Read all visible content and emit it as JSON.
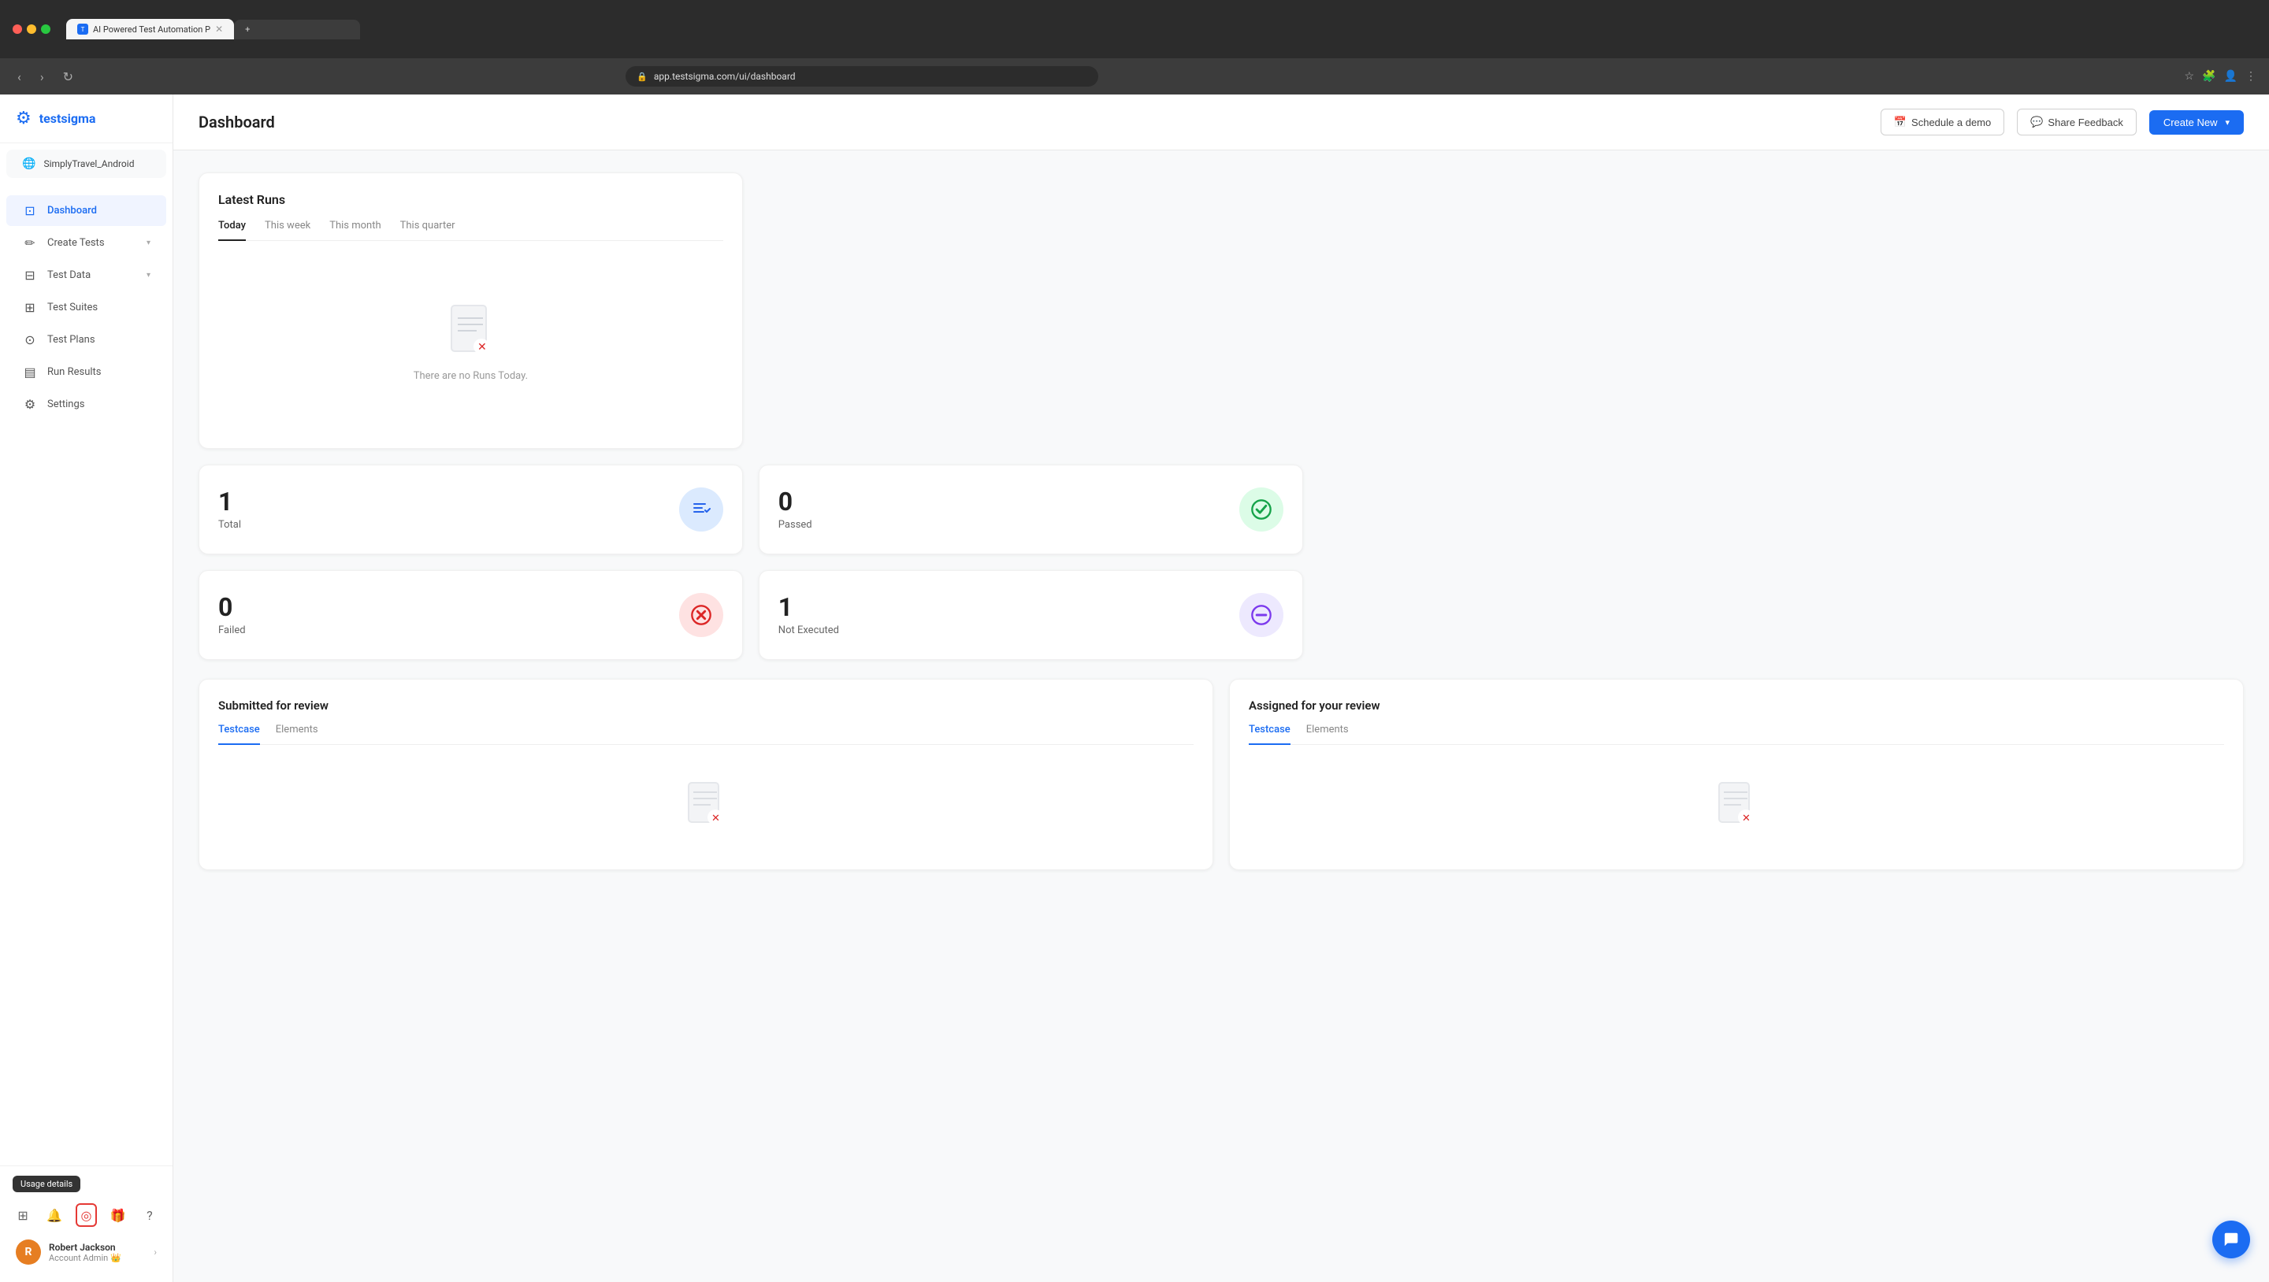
{
  "browser": {
    "tab_title": "AI Powered Test Automation P",
    "tab_new_label": "+",
    "address": "app.testsigma.com/ui/dashboard",
    "nav_back": "‹",
    "nav_forward": "›",
    "nav_refresh": "↻"
  },
  "logo": {
    "icon": "⚙",
    "text": "testsigma"
  },
  "sidebar": {
    "project_name": "SimplyTravel_Android",
    "items": [
      {
        "id": "dashboard",
        "label": "Dashboard",
        "icon": "⊡",
        "active": true
      },
      {
        "id": "create-tests",
        "label": "Create Tests",
        "icon": "✏",
        "has_chevron": true
      },
      {
        "id": "test-data",
        "label": "Test Data",
        "icon": "⊟",
        "has_chevron": true
      },
      {
        "id": "test-suites",
        "label": "Test Suites",
        "icon": "⊞"
      },
      {
        "id": "test-plans",
        "label": "Test Plans",
        "icon": "⊙"
      },
      {
        "id": "run-results",
        "label": "Run Results",
        "icon": "▤"
      },
      {
        "id": "settings",
        "label": "Settings",
        "icon": "⚙"
      }
    ],
    "bottom_icons": [
      {
        "id": "grid-icon",
        "symbol": "⊞",
        "highlighted": false
      },
      {
        "id": "bell-icon",
        "symbol": "🔔",
        "highlighted": false
      },
      {
        "id": "circle-icon",
        "symbol": "◎",
        "highlighted": true
      },
      {
        "id": "gift-icon",
        "symbol": "🎁",
        "highlighted": false
      },
      {
        "id": "help-icon",
        "symbol": "?",
        "highlighted": false
      }
    ],
    "usage_tooltip": "Usage details",
    "user": {
      "initial": "R",
      "name": "Robert Jackson",
      "role": "Account Admin",
      "crown": "👑"
    }
  },
  "header": {
    "title": "Dashboard",
    "schedule_demo_label": "Schedule a demo",
    "share_feedback_label": "Share Feedback",
    "create_new_label": "Create New",
    "schedule_icon": "📅",
    "feedback_icon": "💬",
    "chevron_down": "▾"
  },
  "stats": {
    "total": {
      "number": "1",
      "label": "Total"
    },
    "passed": {
      "number": "0",
      "label": "Passed"
    },
    "failed": {
      "number": "0",
      "label": "Failed"
    },
    "not_executed": {
      "number": "1",
      "label": "Not Executed"
    }
  },
  "latest_runs": {
    "title": "Latest Runs",
    "tabs": [
      {
        "id": "today",
        "label": "Today",
        "active": true
      },
      {
        "id": "this-week",
        "label": "This week",
        "active": false
      },
      {
        "id": "this-month",
        "label": "This month",
        "active": false
      },
      {
        "id": "this-quarter",
        "label": "This quarter",
        "active": false
      }
    ],
    "empty_message": "There are no Runs Today."
  },
  "submitted_review": {
    "title": "Submitted for review",
    "tabs": [
      {
        "id": "testcase",
        "label": "Testcase",
        "active": true
      },
      {
        "id": "elements",
        "label": "Elements",
        "active": false
      }
    ]
  },
  "assigned_review": {
    "title": "Assigned for your review",
    "tabs": [
      {
        "id": "testcase",
        "label": "Testcase",
        "active": true
      },
      {
        "id": "elements",
        "label": "Elements",
        "active": false
      }
    ]
  },
  "chat_button_icon": "💬"
}
